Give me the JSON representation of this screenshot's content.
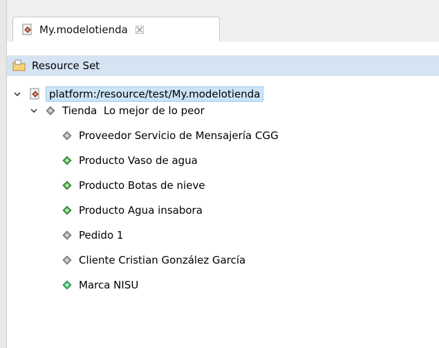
{
  "tab": {
    "title": "My.modelotienda",
    "icon": "model-file-icon",
    "close_icon": "close-icon"
  },
  "tree": {
    "resource_set_label": "Resource Set",
    "root": {
      "label": "platform:/resource/test/My.modelotienda",
      "icon": "model-file-icon",
      "expanded": true
    },
    "tienda": {
      "type": "Tienda",
      "name": "Lo mejor de lo peor",
      "expanded": true
    },
    "children": [
      {
        "label": "Proveedor Servicio de Mensajería CGG",
        "icon": "diamond-gray-icon",
        "color": "#808080"
      },
      {
        "label": "Producto Vaso de agua",
        "icon": "diamond-green-icon",
        "color": "#3a9a3a"
      },
      {
        "label": "Producto Botas de nieve",
        "icon": "diamond-green-icon",
        "color": "#3a9a3a"
      },
      {
        "label": "Producto Agua insabora",
        "icon": "diamond-green-icon",
        "color": "#3a9a3a"
      },
      {
        "label": "Pedido 1",
        "icon": "diamond-gray-icon",
        "color": "#808080"
      },
      {
        "label": "Cliente Cristian González García",
        "icon": "diamond-gray-icon",
        "color": "#808080"
      },
      {
        "label": "Marca NISU",
        "icon": "diamond-green-icon",
        "color": "#3ab86a"
      }
    ]
  },
  "colors": {
    "selection_bg": "#cce4f7",
    "resource_set_bg": "#d6e3f2"
  }
}
